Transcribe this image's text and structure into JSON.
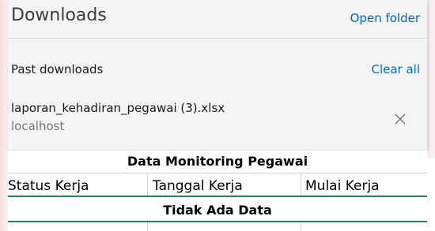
{
  "downloads_panel": {
    "title": "Downloads",
    "open_folder_label": "Open folder",
    "section_label": "Past downloads",
    "clear_all_label": "Clear all",
    "items": [
      {
        "filename": "laporan_kehadiran_pegawai (3).xlsx",
        "source": "localhost",
        "close_icon": "close-icon"
      }
    ]
  },
  "spreadsheet": {
    "title": "Data Monitoring Pegawai",
    "columns": [
      "Status Kerja",
      "Tanggal Kerja",
      "Mulai Kerja"
    ],
    "empty_message": "Tidak Ada Data"
  },
  "colors": {
    "link": "#0067b8",
    "header_rule": "#2e7d4f"
  }
}
